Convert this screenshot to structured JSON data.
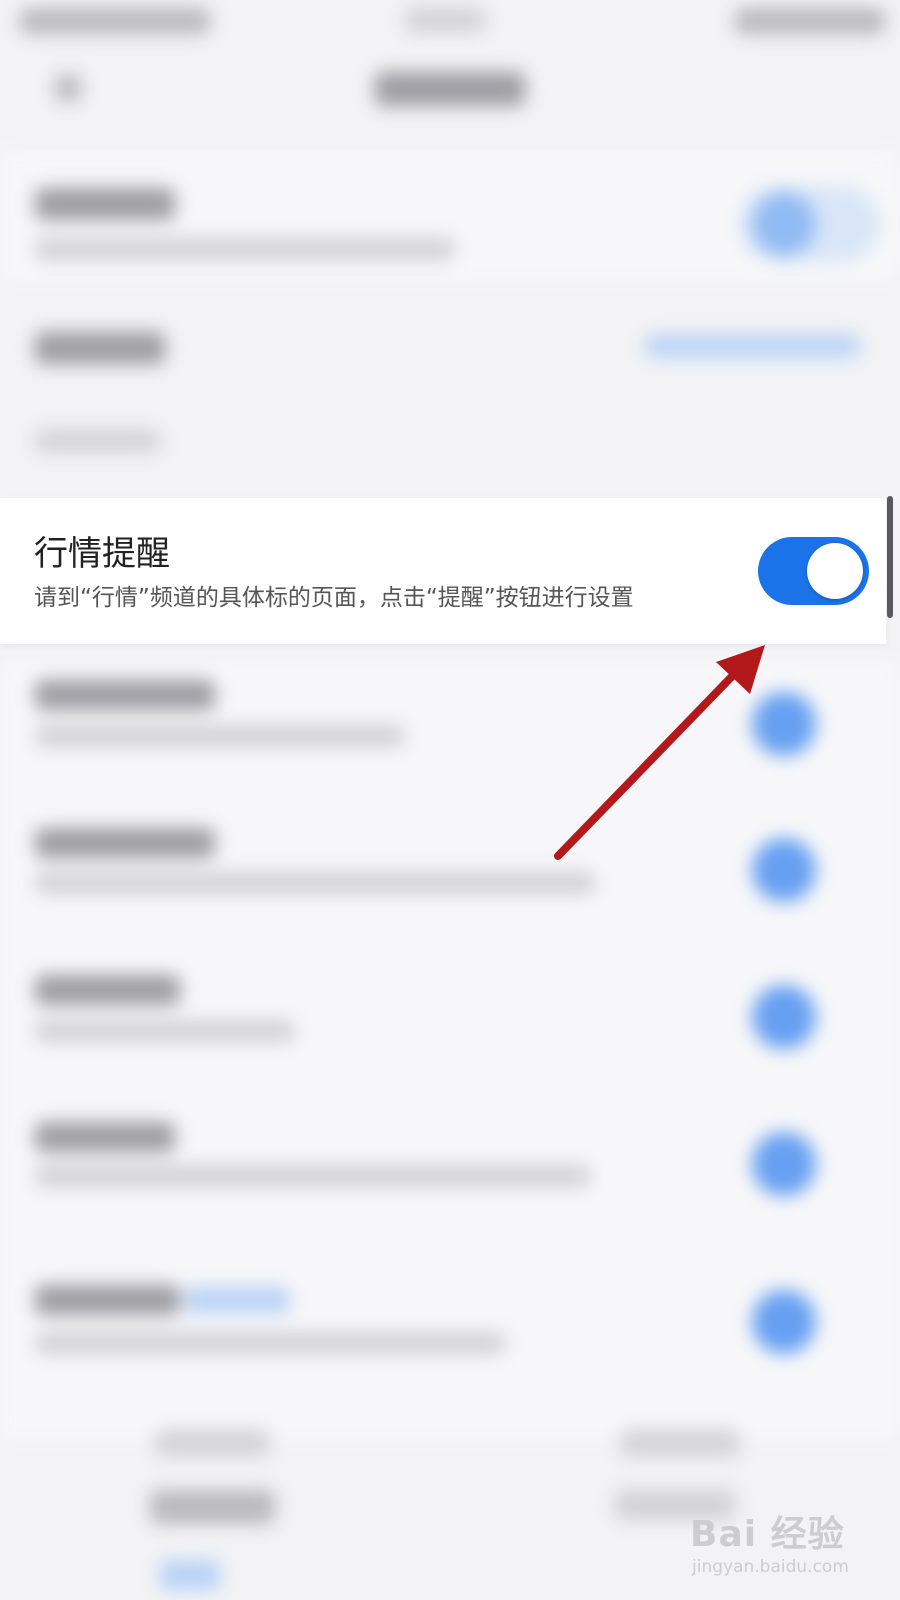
{
  "card": {
    "title": "行情提醒",
    "description": "请到“行情”频道的具体标的页面，点击“提醒”按钮进行设置",
    "toggle_state": "on"
  },
  "colors": {
    "toggle_on": "#1a73e8",
    "arrow": "#b3191b",
    "background": "#f3f3f5"
  },
  "annotation": {
    "type": "arrow",
    "points_to": "toggle-switch"
  },
  "watermark": {
    "logo_text": "Bai  经验",
    "sub_text": "jingyan.baidu.com"
  }
}
